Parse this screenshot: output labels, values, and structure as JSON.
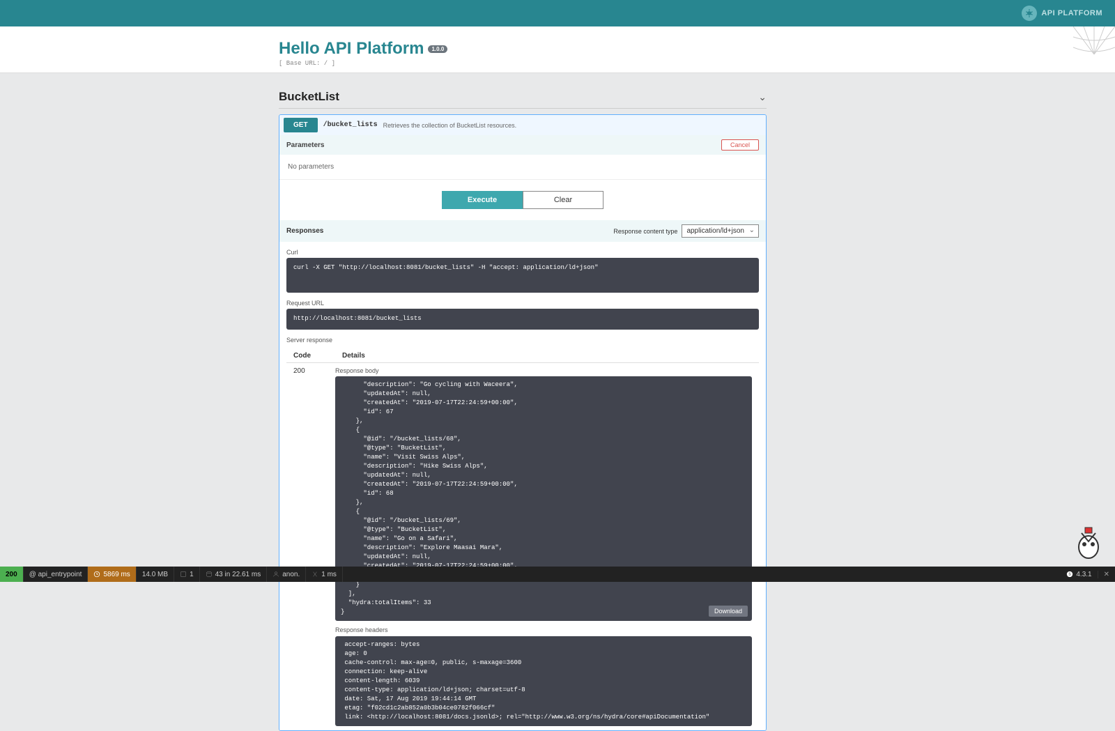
{
  "brand": {
    "name": "API PLATFORM"
  },
  "header": {
    "title": "Hello API Platform",
    "version": "1.0.0",
    "base_url_label": "[ Base URL: / ]"
  },
  "tag": {
    "name": "BucketList"
  },
  "operation": {
    "method": "GET",
    "path": "/bucket_lists",
    "description": "Retrieves the collection of BucketList resources."
  },
  "parameters": {
    "heading": "Parameters",
    "cancel": "Cancel",
    "no_params": "No parameters"
  },
  "buttons": {
    "execute": "Execute",
    "clear": "Clear",
    "download": "Download"
  },
  "responses": {
    "heading": "Responses",
    "content_type_label": "Response content type",
    "content_type_value": "application/ld+json",
    "curl_label": "Curl",
    "curl_command": "curl -X GET \"http://localhost:8081/bucket_lists\" -H \"accept: application/ld+json\"",
    "request_url_label": "Request URL",
    "request_url": "http://localhost:8081/bucket_lists",
    "server_response_label": "Server response",
    "code_header": "Code",
    "details_header": "Details",
    "code": "200",
    "body_label": "Response body",
    "body_text": "      \"description\": \"Go cycling with Waceera\",\n      \"updatedAt\": null,\n      \"createdAt\": \"2019-07-17T22:24:59+00:00\",\n      \"id\": 67\n    },\n    {\n      \"@id\": \"/bucket_lists/68\",\n      \"@type\": \"BucketList\",\n      \"name\": \"Visit Swiss Alps\",\n      \"description\": \"Hike Swiss Alps\",\n      \"updatedAt\": null,\n      \"createdAt\": \"2019-07-17T22:24:59+00:00\",\n      \"id\": 68\n    },\n    {\n      \"@id\": \"/bucket_lists/69\",\n      \"@type\": \"BucketList\",\n      \"name\": \"Go on a Safari\",\n      \"description\": \"Explore Maasai Mara\",\n      \"updatedAt\": null,\n      \"createdAt\": \"2019-07-17T22:24:59+00:00\",\n      \"id\": 69\n    }\n  ],\n  \"hydra:totalItems\": 33\n}",
    "headers_label": "Response headers",
    "headers_text": " accept-ranges: bytes\n age: 0\n cache-control: max-age=0, public, s-maxage=3600\n connection: keep-alive\n content-length: 6039\n content-type: application/ld+json; charset=utf-8\n date: Sat, 17 Aug 2019 19:44:14 GMT\n etag: \"f02cd1c2ab852a0b3b04ce0782f066cf\"\n link: <http://localhost:8081/docs.jsonld>; rel=\"http://www.w3.org/ns/hydra/core#apiDocumentation\""
  },
  "debug": {
    "status": "200",
    "route": "@ api_entrypoint",
    "time": "5869 ms",
    "memory": "14.0 MB",
    "forms": "1",
    "queries": "43 in 22.61 ms",
    "user": "anon.",
    "time2": "1 ms",
    "version": "4.3.1"
  }
}
